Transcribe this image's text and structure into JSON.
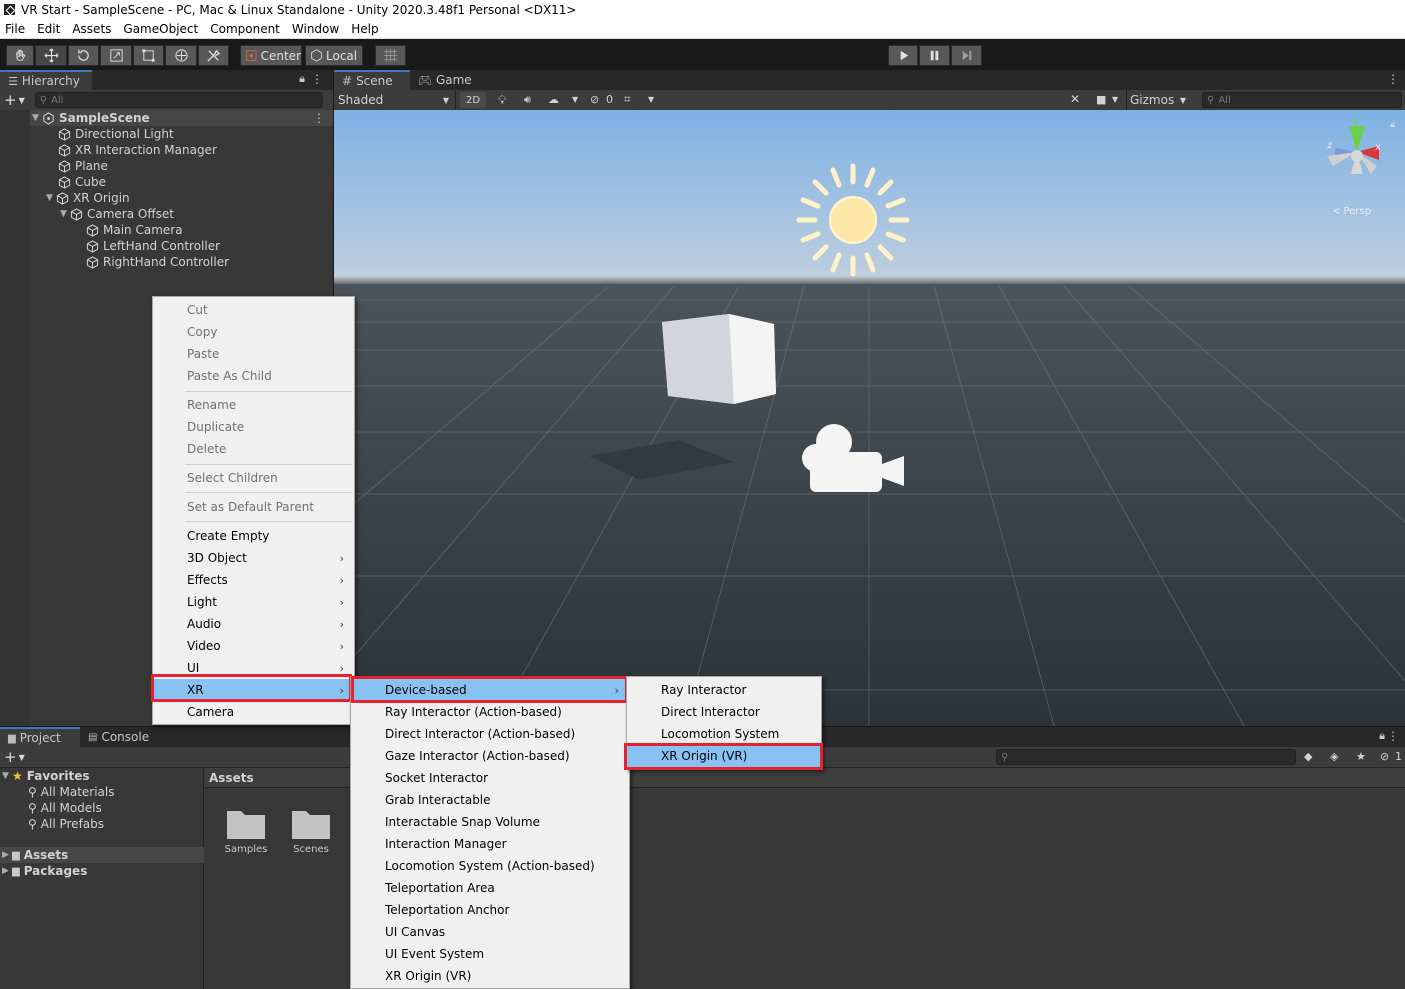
{
  "window": {
    "title": "VR Start - SampleScene - PC, Mac & Linux Standalone - Unity 2020.3.48f1 Personal <DX11>"
  },
  "menubar": [
    "File",
    "Edit",
    "Assets",
    "GameObject",
    "Component",
    "Window",
    "Help"
  ],
  "toolbar": {
    "pivot_label": "Center",
    "space_label": "Local"
  },
  "hierarchy": {
    "tab": "Hierarchy",
    "search_placeholder": "All",
    "scene": "SampleScene",
    "items": [
      "Directional Light",
      "XR Interaction Manager",
      "Plane",
      "Cube",
      "XR Origin",
      "Camera Offset",
      "Main Camera",
      "LeftHand Controller",
      "RightHand Controller"
    ]
  },
  "scene_view": {
    "tabs": [
      "Scene",
      "Game"
    ],
    "shading": "Shaded",
    "mode_2d": "2D",
    "hidden_count": "0",
    "gizmos": "Gizmos",
    "search_placeholder": "All",
    "persp_label": "< Persp",
    "axis_y": "y",
    "axis_z": "z",
    "axis_x": "x"
  },
  "context_menu": {
    "items": [
      "Cut",
      "Copy",
      "Paste",
      "Paste As Child",
      "Rename",
      "Duplicate",
      "Delete",
      "Select Children",
      "Set as Default Parent",
      "Create Empty",
      "3D Object",
      "Effects",
      "Light",
      "Audio",
      "Video",
      "UI",
      "XR",
      "Camera"
    ]
  },
  "xr_menu": {
    "items": [
      "Device-based",
      "Ray Interactor (Action-based)",
      "Direct Interactor (Action-based)",
      "Gaze Interactor (Action-based)",
      "Socket Interactor",
      "Grab Interactable",
      "Interactable Snap Volume",
      "Interaction Manager",
      "Locomotion System (Action-based)",
      "Teleportation Area",
      "Teleportation Anchor",
      "UI Canvas",
      "UI Event System",
      "XR Origin (VR)"
    ]
  },
  "device_menu": {
    "items": [
      "Ray Interactor",
      "Direct Interactor",
      "Locomotion System",
      "XR Origin (VR)"
    ]
  },
  "project": {
    "tabs": [
      "Project",
      "Console"
    ],
    "favorites_label": "Favorites",
    "favorites": [
      "All Materials",
      "All Models",
      "All Prefabs"
    ],
    "roots": [
      "Assets",
      "Packages"
    ],
    "assets_header": "Assets",
    "folders": [
      "Samples",
      "Scenes"
    ],
    "hidden_count": "1"
  },
  "colors": {
    "highlight": "#88c2f2",
    "annotation": "#e5222d",
    "selection_blue": "#3a79bb"
  }
}
